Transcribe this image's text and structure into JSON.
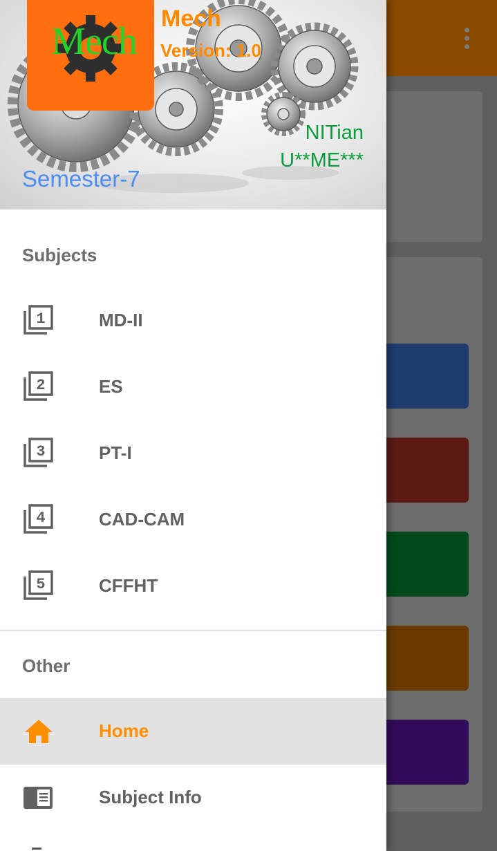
{
  "background": {
    "overflow_icon": "more-vert-icon",
    "tiles": [
      {
        "color": "#1e3c6e"
      },
      {
        "color": "#5c1a14"
      },
      {
        "color": "#024a1c"
      },
      {
        "color": "#6a3a00"
      },
      {
        "color": "#320b5a"
      }
    ]
  },
  "header": {
    "logo_text": "Mech",
    "app_name": "Mech",
    "version": "Version: 1.0",
    "user_name": "NITian",
    "roll_no": "U**ME***",
    "semester": "Semester-7"
  },
  "subjects": {
    "title": "Subjects",
    "items": [
      {
        "label": "MD-II",
        "icon": "filter-1-icon",
        "num": "1"
      },
      {
        "label": "ES",
        "icon": "filter-2-icon",
        "num": "2"
      },
      {
        "label": "PT-I",
        "icon": "filter-3-icon",
        "num": "3"
      },
      {
        "label": "CAD-CAM",
        "icon": "filter-4-icon",
        "num": "4"
      },
      {
        "label": "CFFHT",
        "icon": "filter-5-icon",
        "num": "5"
      }
    ]
  },
  "other": {
    "title": "Other",
    "items": [
      {
        "label": "Home",
        "icon": "home-icon",
        "active": true
      },
      {
        "label": "Subject Info",
        "icon": "view-list-icon",
        "active": false
      }
    ]
  },
  "colors": {
    "accent": "#ff8f00",
    "logo_bg": "#ff6f0f",
    "logo_text": "#22d42a",
    "semester": "#4b8cf0",
    "user": "#0c9c3c"
  }
}
